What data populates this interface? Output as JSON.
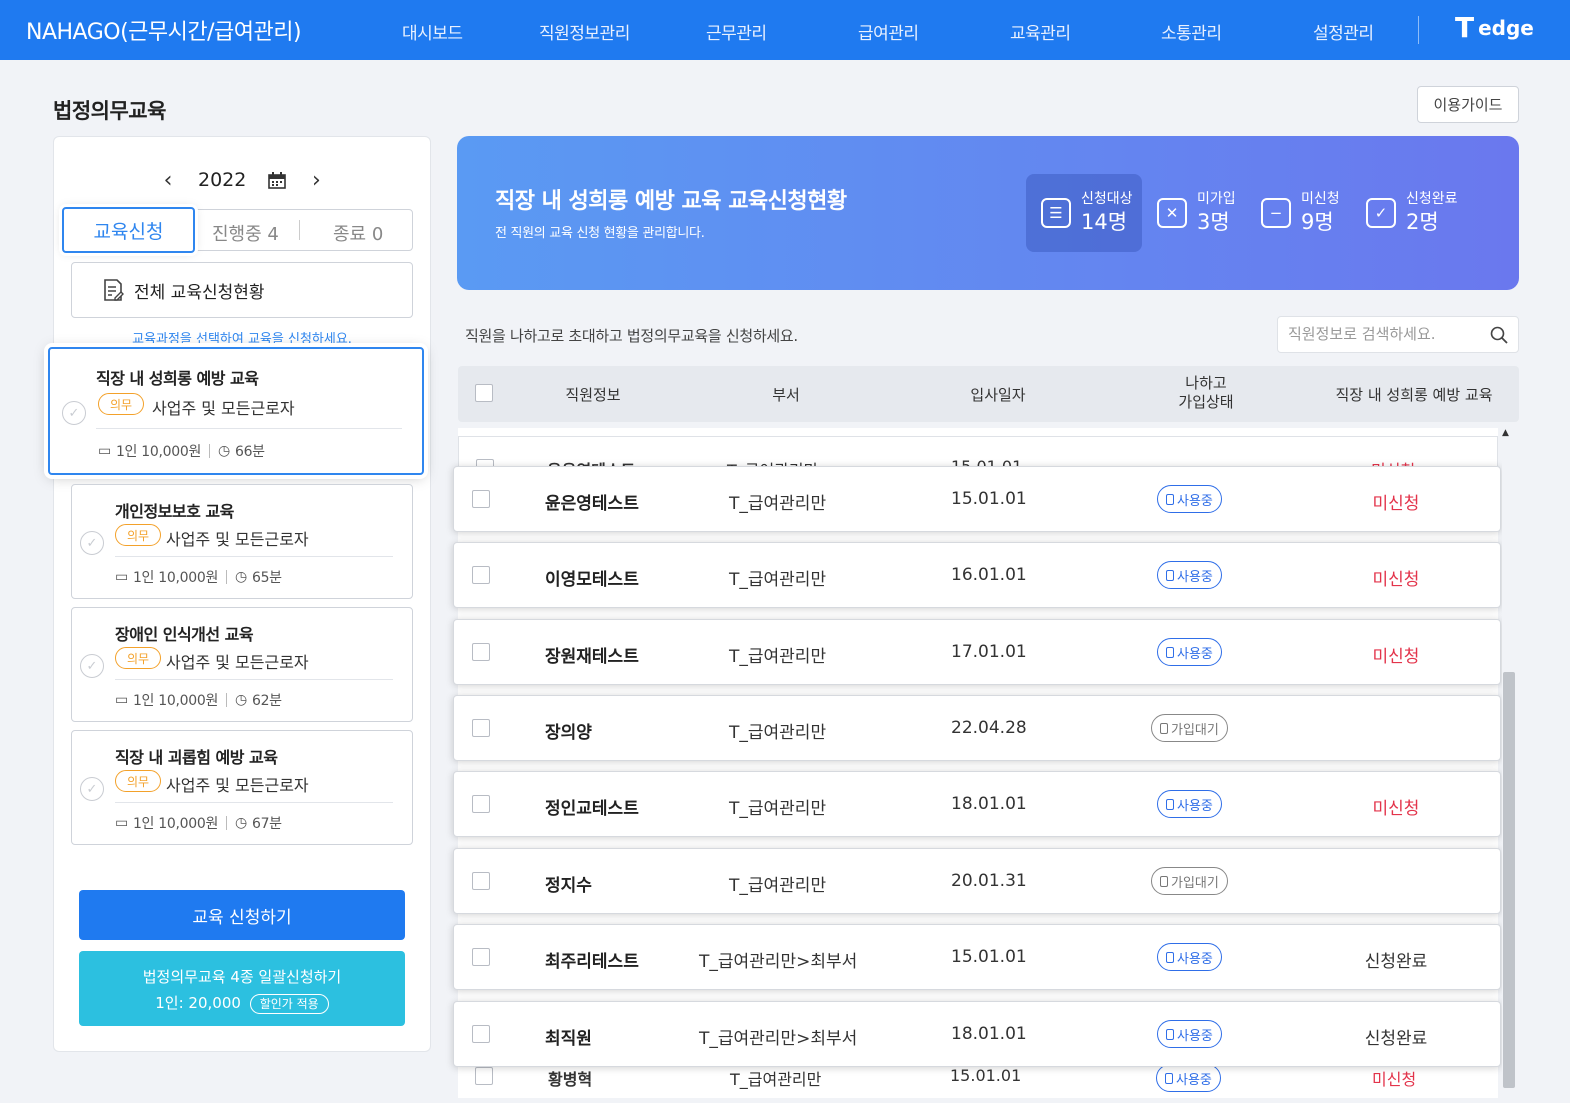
{
  "brand": "NAHAGO(근무시간/급여관리)",
  "nav": [
    "대시보드",
    "직원정보관리",
    "근무관리",
    "급여관리",
    "교육관리",
    "소통관리",
    "설정관리"
  ],
  "partner_logo": "edge",
  "page_title": "법정의무교육",
  "guide_button": "이용가이드",
  "year": "2022",
  "tabs": {
    "apply": "교육신청",
    "in_progress": "진행중 4",
    "done": "종료 0"
  },
  "all_status": "전체 교육신청현황",
  "hint": "교육과정을 선택하여 교육을 신청하세요.",
  "courses": [
    {
      "title": "직장 내 성희롱 예방 교육",
      "badge": "의무",
      "target": "사업주 및 모든근로자",
      "price": "1인 10,000원",
      "duration": "66분"
    },
    {
      "title": "개인정보보호 교육",
      "badge": "의무",
      "target": "사업주 및 모든근로자",
      "price": "1인 10,000원",
      "duration": "65분"
    },
    {
      "title": "장애인 인식개선 교육",
      "badge": "의무",
      "target": "사업주 및 모든근로자",
      "price": "1인 10,000원",
      "duration": "62분"
    },
    {
      "title": "직장 내 괴롭힘 예방 교육",
      "badge": "의무",
      "target": "사업주 및 모든근로자",
      "price": "1인 10,000원",
      "duration": "67분"
    }
  ],
  "apply_button": "교육 신청하기",
  "bulk_button": {
    "line1": "법정의무교육 4종 일괄신청하기",
    "line2": "1인: 20,000",
    "discount": "할인가 적용"
  },
  "banner": {
    "title": "직장 내 성희롱 예방 교육 교육신청현황",
    "subtitle": "전 직원의 교육 신청 현황을 관리합니다.",
    "stats": [
      {
        "label": "신청대상",
        "value": "14명",
        "icon": "list-icon"
      },
      {
        "label": "미가입",
        "value": "3명",
        "icon": "x-box-icon"
      },
      {
        "label": "미신청",
        "value": "9명",
        "icon": "minus-box-icon"
      },
      {
        "label": "신청완료",
        "value": "2명",
        "icon": "check-box-icon"
      }
    ]
  },
  "table_desc": "직원을 나하고로 초대하고 법정의무교육을 신청하세요.",
  "search_placeholder": "직원정보로 검색하세요.",
  "columns": {
    "info": "직원정보",
    "dept": "부서",
    "date": "입사일자",
    "join_1": "나하고",
    "join_2": "가입상태",
    "course": "직장 내 성희롱 예방 교육"
  },
  "ghost_top": {
    "name": "윤은영테스트",
    "dept": "T_급여관리만",
    "date": "15.01.01",
    "state": "미신청"
  },
  "rows": [
    {
      "name": "윤은영테스트",
      "dept": "T_급여관리만",
      "date": "15.01.01",
      "join": "사용중",
      "join_type": "active",
      "state": "미신청",
      "state_type": "no"
    },
    {
      "name": "이영모테스트",
      "dept": "T_급여관리만",
      "date": "16.01.01",
      "join": "사용중",
      "join_type": "active",
      "state": "미신청",
      "state_type": "no"
    },
    {
      "name": "장원재테스트",
      "dept": "T_급여관리만",
      "date": "17.01.01",
      "join": "사용중",
      "join_type": "active",
      "state": "미신청",
      "state_type": "no"
    },
    {
      "name": "장의양",
      "dept": "T_급여관리만",
      "date": "22.04.28",
      "join": "가입대기",
      "join_type": "wait",
      "state": "",
      "state_type": "none"
    },
    {
      "name": "정인교테스트",
      "dept": "T_급여관리만",
      "date": "18.01.01",
      "join": "사용중",
      "join_type": "active",
      "state": "미신청",
      "state_type": "no"
    },
    {
      "name": "정지수",
      "dept": "T_급여관리만",
      "date": "20.01.31",
      "join": "가입대기",
      "join_type": "wait",
      "state": "",
      "state_type": "none"
    },
    {
      "name": "최주리테스트",
      "dept": "T_급여관리만>최부서",
      "date": "15.01.01",
      "join": "사용중",
      "join_type": "active",
      "state": "신청완료",
      "state_type": "done"
    },
    {
      "name": "최직원",
      "dept": "T_급여관리만>최부서",
      "date": "18.01.01",
      "join": "사용중",
      "join_type": "active",
      "state": "신청완료",
      "state_type": "done"
    }
  ],
  "ghost_bottom": {
    "name": "황병혁",
    "dept": "T_급여관리만",
    "date": "15.01.01",
    "join": "사용중",
    "state": "미신청"
  }
}
